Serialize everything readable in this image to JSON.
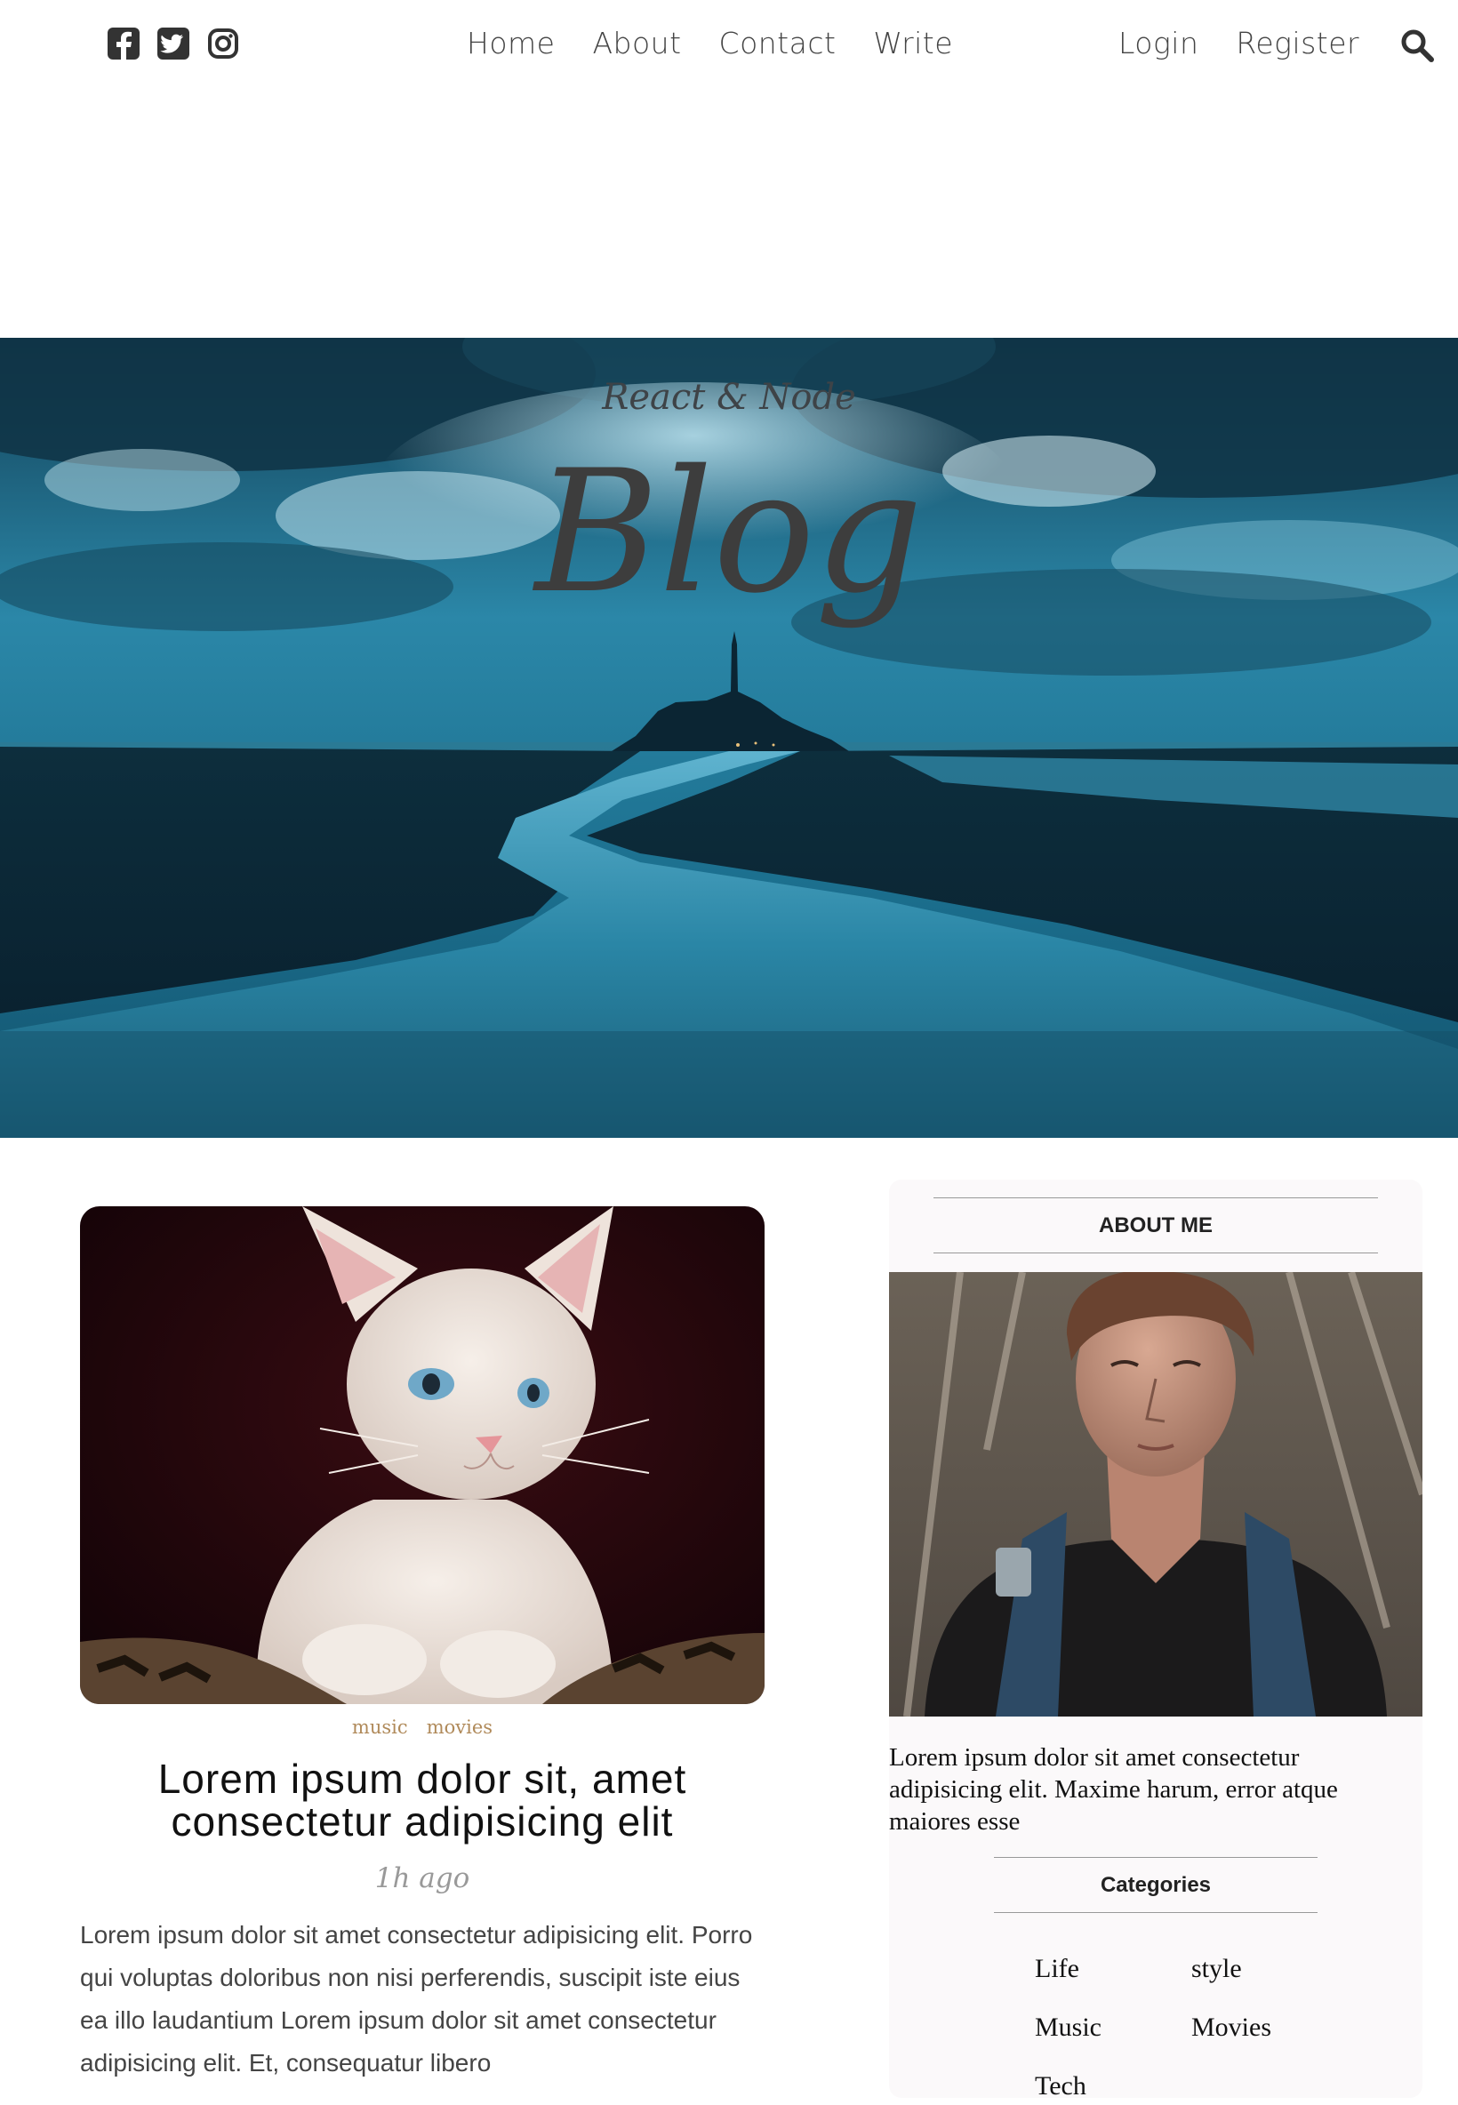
{
  "social": [
    "facebook-square-icon",
    "twitter-square-icon",
    "instagram-icon"
  ],
  "nav": {
    "items": [
      "Home",
      "About",
      "Contact",
      "Write"
    ],
    "auth": [
      "Login",
      "Register"
    ],
    "search_icon": "search-icon"
  },
  "hero": {
    "subtitle": "React & Node",
    "title": "Blog"
  },
  "post": {
    "categories": [
      "music",
      "movies"
    ],
    "title": "Lorem ipsum dolor sit, amet consectetur adipisicing elit",
    "date": "1h ago",
    "description": "Lorem ipsum dolor sit amet consectetur adipisicing elit. Porro qui voluptas doloribus non nisi perferendis, suscipit iste eius ea illo laudantium Lorem ipsum dolor sit amet consectetur adipisicing elit. Et, consequatur libero"
  },
  "sidebar": {
    "about_title": "ABOUT ME",
    "about_text": "Lorem ipsum dolor sit amet consectetur adipisicing elit. Maxime harum, error atque maiores esse",
    "categories_title": "Categories",
    "categories": [
      "Life",
      "style",
      "Music",
      "Movies",
      "Tech"
    ]
  },
  "colors": {
    "text": "#444444",
    "category_accent": "#b08a5a",
    "sidebar_bg": "#fbf9fa",
    "hero_tint": "#1c6f8e"
  }
}
